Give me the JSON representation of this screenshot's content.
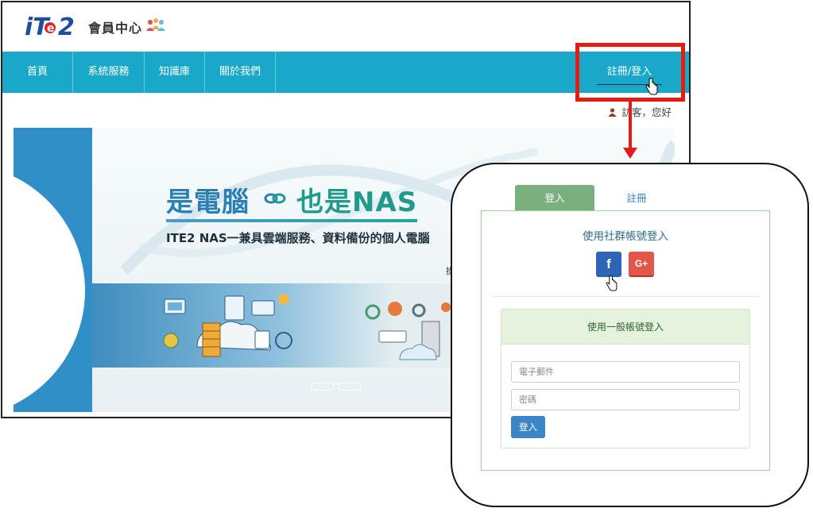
{
  "header": {
    "logo_text": "iTE2",
    "title": "會員中心",
    "members_icon": "people-group-icon"
  },
  "navbar": {
    "items": [
      {
        "label": "首頁"
      },
      {
        "label": "系統服務"
      },
      {
        "label": "知識庫"
      },
      {
        "label": "關於我們"
      }
    ],
    "login_label": "註冊/登入"
  },
  "greeting": "訪客，您好",
  "banner": {
    "headline_a": "是電腦",
    "headline_b": "也是NAS",
    "subtitle": "ITE2 NAS一兼具雲端服務、資料備份的個人電腦",
    "partial_text": "操",
    "prev_icon": "chevron-left-icon",
    "slide_indicators": 2
  },
  "login_panel": {
    "tabs": [
      {
        "label": "登入",
        "active": true
      },
      {
        "label": "註冊",
        "active": false
      }
    ],
    "social_title": "使用社群帳號登入",
    "social_buttons": [
      {
        "label": "f",
        "icon": "facebook-icon"
      },
      {
        "label": "G+",
        "icon": "google-plus-icon"
      }
    ],
    "general_title": "使用一般帳號登入",
    "email_placeholder": "電子郵件",
    "password_placeholder": "密碼",
    "submit_label": "登入"
  },
  "colors": {
    "nav": "#1aa8c9",
    "highlight": "#e41b17",
    "tab_active": "#79b07e",
    "facebook": "#2e64b8",
    "google": "#e2574a",
    "submit": "#3a86c6"
  }
}
